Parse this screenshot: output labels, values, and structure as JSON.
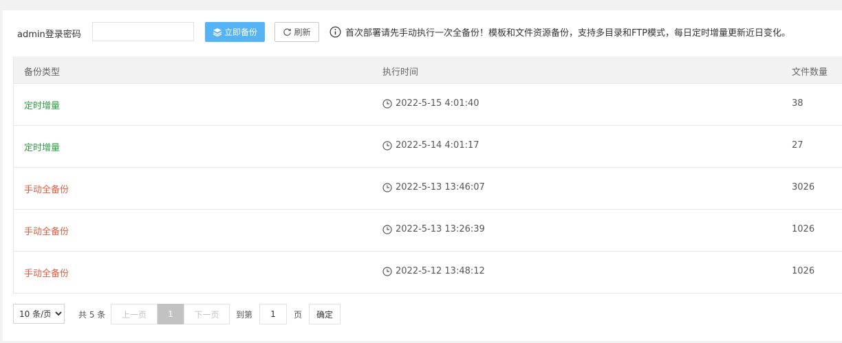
{
  "toolbar": {
    "password_label": "admin登录密码",
    "password_value": "",
    "password_placeholder": "",
    "backup_button": "立即备份",
    "refresh_button": "刷新",
    "notice": "首次部署请先手动执行一次全备份！模板和文件资源备份，支持多目录和FTP模式，每日定时增量更新近日变化。"
  },
  "table": {
    "headers": [
      "备份类型",
      "执行时间",
      "文件数量"
    ],
    "rows": [
      {
        "type": "定时增量",
        "time": "2022-5-15 4:01:40",
        "count": "38"
      },
      {
        "type": "定时增量",
        "time": "2022-5-14 4:01:17",
        "count": "27"
      },
      {
        "type": "手动全备份",
        "time": "2022-5-13 13:46:07",
        "count": "3026"
      },
      {
        "type": "手动全备份",
        "time": "2022-5-13 13:26:39",
        "count": "1026"
      },
      {
        "type": "手动全备份",
        "time": "2022-5-12 13:48:12",
        "count": "1026"
      }
    ]
  },
  "pagination": {
    "page_size": "10 条/页",
    "page_size_options": [
      "10 条/页"
    ],
    "total": "共 5 条",
    "prev": "上一页",
    "current": "1",
    "next": "下一页",
    "goto_label": "到第",
    "goto_value": "1",
    "page_unit": "页",
    "confirm": "确定"
  },
  "colors": {
    "primary": "#56b4f4",
    "incremental": "#2e9e44",
    "full": "#e05b3f",
    "header_bg": "#f2f2f2"
  },
  "icons": {
    "backup": "layers-icon",
    "refresh": "refresh-icon",
    "notice": "info-icon",
    "time": "clock-icon"
  }
}
